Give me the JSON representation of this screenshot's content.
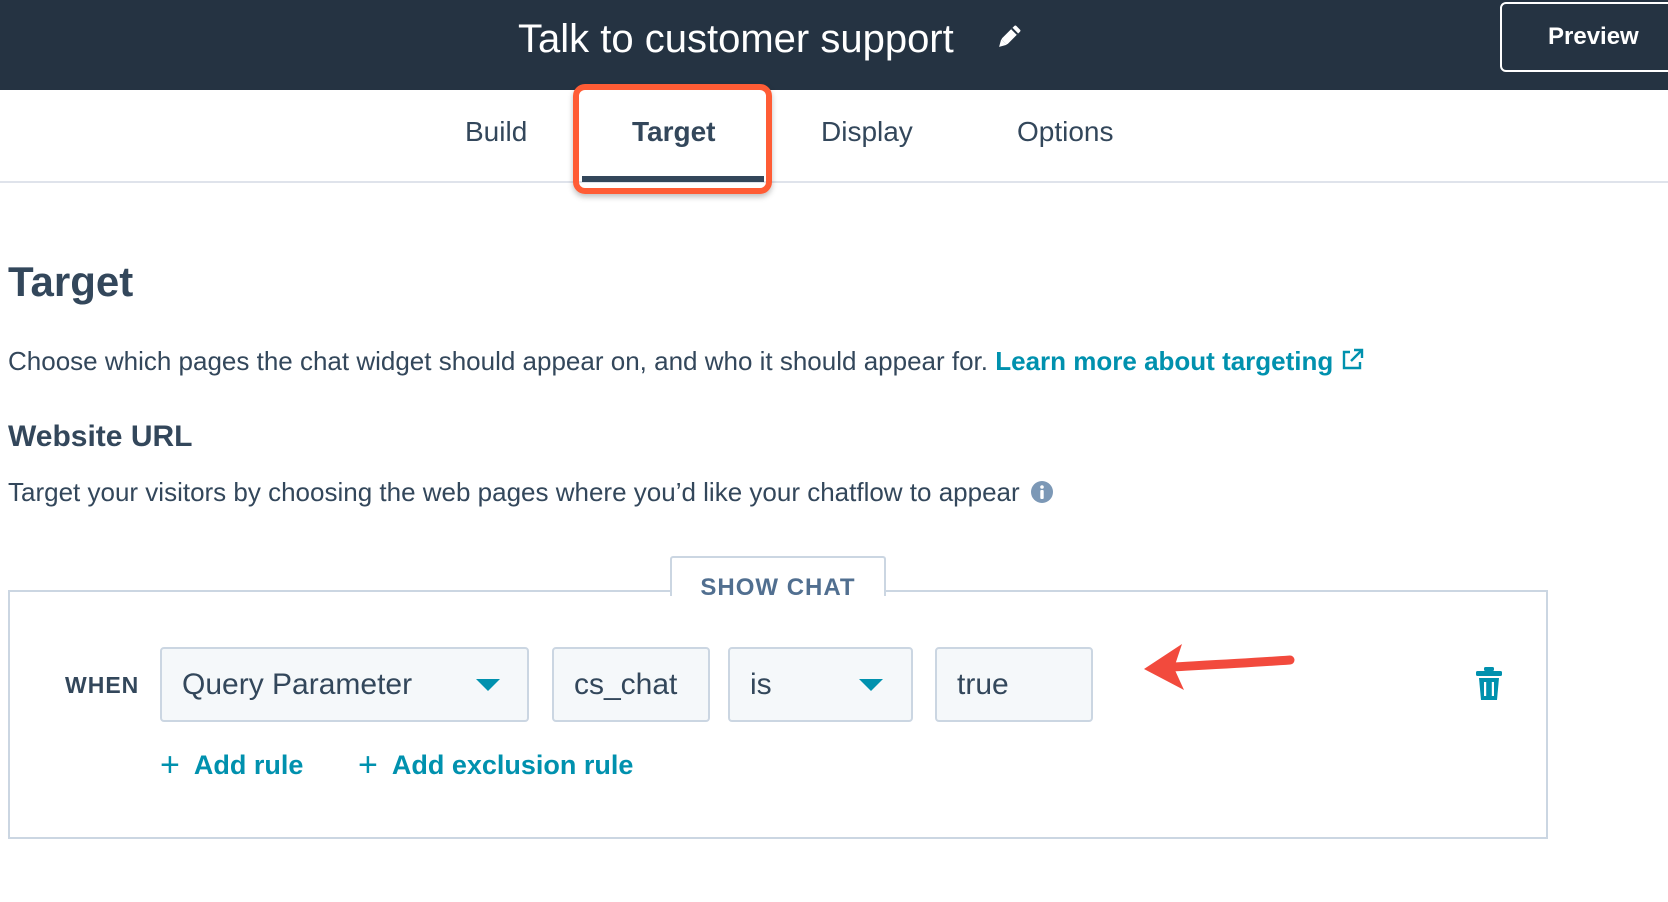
{
  "header": {
    "title": "Talk to customer support",
    "edit_icon": "pencil-icon",
    "preview_label": "Preview"
  },
  "tabs": [
    {
      "label": "Build",
      "active": false
    },
    {
      "label": "Target",
      "active": true
    },
    {
      "label": "Display",
      "active": false
    },
    {
      "label": "Options",
      "active": false
    }
  ],
  "page": {
    "heading": "Target",
    "description": "Choose which pages the chat widget should appear on, and who it should appear for.",
    "learn_more_link": "Learn more about targeting",
    "external_icon": "external-link-icon"
  },
  "website_url": {
    "heading": "Website URL",
    "description": "Target your visitors by choosing the web pages where you’d like your chatflow to appear",
    "info_icon": "info-icon"
  },
  "rule_panel": {
    "show_chat_label": "SHOW CHAT",
    "when_label": "WHEN",
    "rule": {
      "type": "Query Parameter",
      "parameter": "cs_chat",
      "operator": "is",
      "value": "true"
    },
    "delete_icon": "trash-icon",
    "add_rule_label": "Add rule",
    "add_exclusion_label": "Add exclusion rule"
  },
  "colors": {
    "header_bg": "#253342",
    "text": "#33475b",
    "link": "#0091ae",
    "highlight": "#ff5c35",
    "border": "#cbd6e2",
    "input_bg": "#f5f8fa"
  }
}
